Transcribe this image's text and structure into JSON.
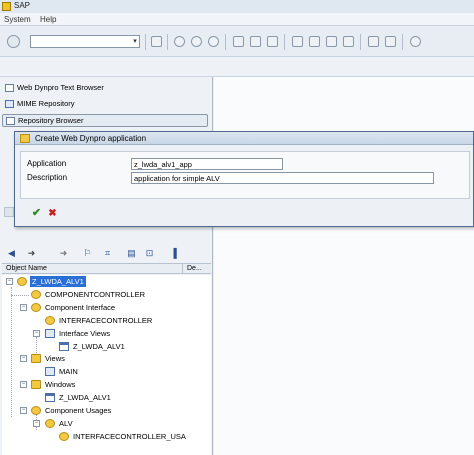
{
  "window": {
    "title": "SAP"
  },
  "menu": {
    "items": [
      "System",
      "Help"
    ]
  },
  "nav": {
    "items": [
      {
        "label": "Web Dynpro Text Browser",
        "icon": "tree-structure-icon"
      },
      {
        "label": "MIME Repository",
        "icon": "mime-icon"
      },
      {
        "label": "Repository Browser",
        "icon": "tree-structure-icon",
        "selected": true
      }
    ]
  },
  "tree": {
    "header": {
      "name_col": "Object Name",
      "desc_col": "De..."
    },
    "nodes": [
      {
        "label": "Z_LWDA_ALV1",
        "selected": true
      },
      {
        "label": "COMPONENTCONTROLLER"
      },
      {
        "label": "Component Interface"
      },
      {
        "label": "INTERFACECONTROLLER"
      },
      {
        "label": "Interface Views"
      },
      {
        "label": "Z_LWDA_ALV1"
      },
      {
        "label": "Views"
      },
      {
        "label": "MAIN"
      },
      {
        "label": "Windows"
      },
      {
        "label": "Z_LWDA_ALV1"
      },
      {
        "label": "Component Usages"
      },
      {
        "label": "ALV"
      },
      {
        "label": "INTERFACECONTROLLER_USA"
      }
    ]
  },
  "dialog": {
    "title": "Create Web Dynpro application",
    "fields": [
      {
        "label": "Application",
        "value": "z_lwda_alv1_app"
      },
      {
        "label": "Description",
        "value": "application for simple ALV"
      }
    ]
  },
  "colors": {
    "selection": "#2a6fd8",
    "accent": "#4f6a8d"
  }
}
